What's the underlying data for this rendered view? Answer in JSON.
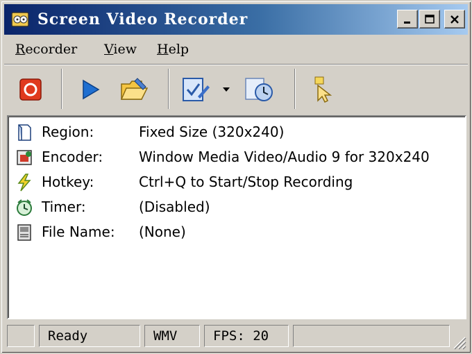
{
  "window": {
    "title": "Screen Video Recorder"
  },
  "menu": {
    "items": [
      {
        "key": "R",
        "rest": "ecorder"
      },
      {
        "key": "V",
        "rest": "iew"
      },
      {
        "key": "H",
        "rest": "elp"
      }
    ]
  },
  "toolbar": {
    "buttons": [
      "record-icon",
      "play-icon",
      "open-folder-icon",
      "edit-options-icon",
      "dropdown-arrow-icon",
      "schedule-timer-icon",
      "select-region-cursor-icon"
    ]
  },
  "info": {
    "rows": [
      {
        "label": "Region:",
        "value": "Fixed Size (320x240)",
        "icon": "region-icon"
      },
      {
        "label": "Encoder:",
        "value": "Window Media Video/Audio 9 for 320x240",
        "icon": "encoder-icon"
      },
      {
        "label": "Hotkey:",
        "value": "Ctrl+Q to Start/Stop Recording",
        "icon": "hotkey-lightning-icon"
      },
      {
        "label": "Timer:",
        "value": "(Disabled)",
        "icon": "timer-icon"
      },
      {
        "label": "File Name:",
        "value": "(None)",
        "icon": "file-icon"
      }
    ]
  },
  "status": {
    "state": "Ready",
    "format": "WMV",
    "fps": "FPS: 20"
  },
  "colors": {
    "titlebar_start": "#0a246a",
    "titlebar_end": "#a6caf0",
    "record_red": "#e03a1e",
    "play_blue": "#1f6fd1"
  }
}
